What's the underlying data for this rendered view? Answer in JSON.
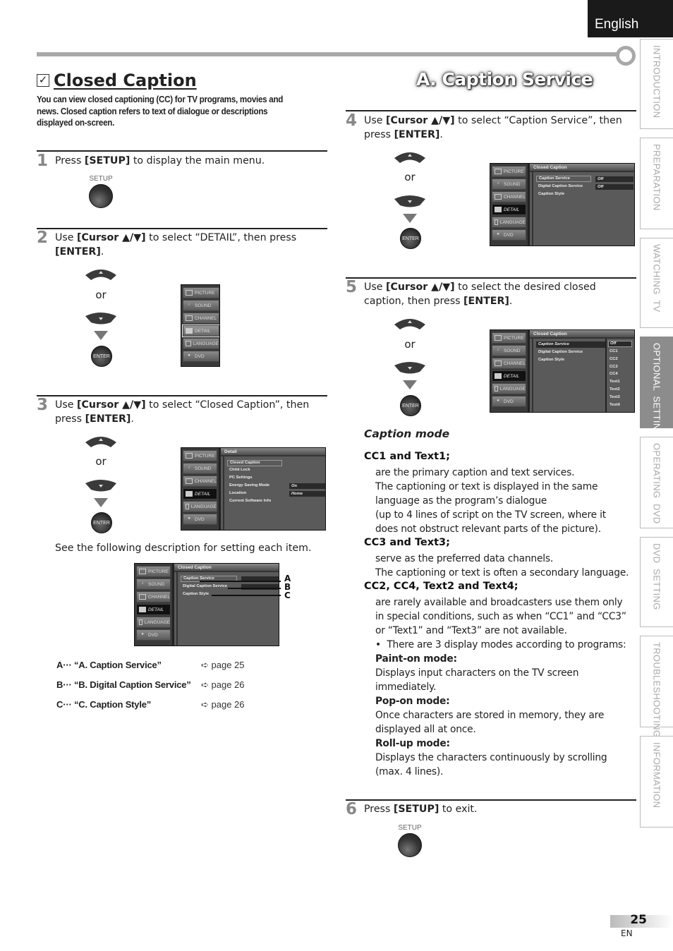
{
  "header": {
    "language": "English"
  },
  "side_tabs": [
    {
      "label": "INTRODUCTION",
      "active": false
    },
    {
      "label": "PREPARATION",
      "active": false
    },
    {
      "label": "WATCHING  TV",
      "active": false
    },
    {
      "label": "OPTIONAL  SETTING",
      "active": true
    },
    {
      "label": "OPERATING  DVD",
      "active": false
    },
    {
      "label": "DVD  SETTING",
      "active": false
    },
    {
      "label": "TROUBLESHOOTING",
      "active": false
    },
    {
      "label": "INFORMATION",
      "active": false
    }
  ],
  "left": {
    "title_icon": "checkbox-icon",
    "title": "Closed Caption",
    "intro": "You can view closed captioning (CC) for TV programs, movies and news. Closed caption refers to text of dialogue or descriptions displayed on-screen.",
    "steps": [
      {
        "num": "1",
        "pre": "Press ",
        "bold1": "[SETUP]",
        "post": " to display the main menu."
      },
      {
        "num": "2",
        "pre": "Use ",
        "bold1": "[Cursor ▲/▼]",
        "mid": " to select “DETAIL”, then press ",
        "bold2": "[ENTER]",
        "post": "."
      },
      {
        "num": "3",
        "pre": "Use ",
        "bold1": "[Cursor ▲/▼]",
        "mid": " to select “Closed Caption”, then press ",
        "bold2": "[ENTER]",
        "post": "."
      }
    ],
    "see_following": "See the following description for setting each item.",
    "references": [
      {
        "key": "A··· “A. Caption Service”",
        "page": "➪ page 25"
      },
      {
        "key": "B··· “B. Digital Caption Service”",
        "page": "➪ page 26"
      },
      {
        "key": "C··· “C. Caption Style”",
        "page": "➪ page 26"
      }
    ],
    "abc_labels": [
      "A",
      "B",
      "C"
    ]
  },
  "right": {
    "title": "A.  Caption Service",
    "steps": [
      {
        "num": "4",
        "pre": "Use ",
        "bold1": "[Cursor ▲/▼]",
        "mid": " to select “Caption Service”, then press ",
        "bold2": "[ENTER]",
        "post": "."
      },
      {
        "num": "5",
        "pre": "Use ",
        "bold1": "[Cursor ▲/▼]",
        "mid": " to select the desired closed caption, then press ",
        "bold2": "[ENTER]",
        "post": "."
      },
      {
        "num": "6",
        "pre": "Press ",
        "bold1": "[SETUP]",
        "post": " to exit."
      }
    ],
    "caption_mode": {
      "title": "Caption mode",
      "cc1_head": "CC1 and Text1;",
      "cc1_lines": [
        "are the primary caption and text services.",
        "The captioning or text is displayed in the same",
        "language as the program’s dialogue",
        "(up to 4 lines of script on the TV screen, where it",
        "does not obstruct relevant parts of the picture)."
      ],
      "cc3_head": "CC3 and Text3;",
      "cc3_lines": [
        "serve as the preferred data channels.",
        "The captioning or text is often a secondary language."
      ],
      "cc2_head": "CC2, CC4, Text2 and Text4;",
      "cc2_lines": [
        "are rarely available and broadcasters use them only",
        "in special conditions, such as when “CC1” and “CC3”",
        "or “Text1” and “Text3” are not available."
      ],
      "bullet": "There are 3 display modes according to programs:",
      "modes": [
        {
          "head": "Paint-on mode:",
          "lines": [
            "Displays input characters on the TV screen",
            "immediately."
          ]
        },
        {
          "head": "Pop-on mode:",
          "lines": [
            "Once characters are stored in memory, they are",
            "displayed all at once."
          ]
        },
        {
          "head": "Roll-up mode:",
          "lines": [
            "Displays the characters continuously by scrolling",
            "(max. 4 lines)."
          ]
        }
      ]
    }
  },
  "remote": {
    "setup_label": "SETUP",
    "enter_label": "ENTER",
    "or_label": "or"
  },
  "tv_menu": {
    "side_items": [
      "PICTURE",
      "SOUND",
      "CHANNEL",
      "DETAIL",
      "LANGUAGE",
      "DVD"
    ],
    "detail_head": "Detail",
    "detail_items": [
      "Closed Caption",
      "Child Lock",
      "PC Settings",
      "Energy Saving Mode",
      "Location",
      "Current Software Info"
    ],
    "detail_values": {
      "energy_saving": "On",
      "location": "Home"
    },
    "cc_head": "Closed Caption",
    "cc_items": [
      "Caption Service",
      "Digital Caption Service",
      "Caption Style"
    ],
    "cc_values": [
      "Off",
      "Off"
    ],
    "cc_options": [
      "Off",
      "CC1",
      "CC2",
      "CC3",
      "CC4",
      "Text1",
      "Text2",
      "Text3",
      "Text4"
    ]
  },
  "footer": {
    "page": "25",
    "lang_code": "EN"
  }
}
